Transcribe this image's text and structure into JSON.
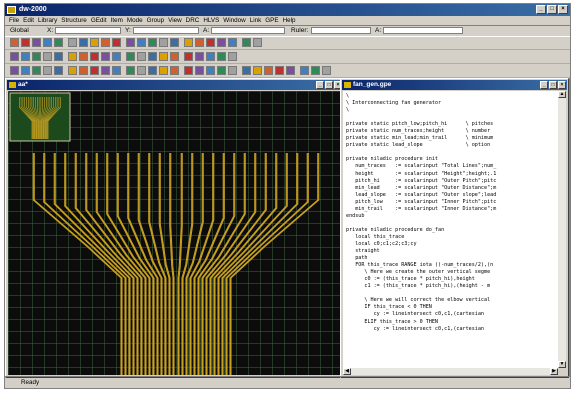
{
  "app": {
    "title": "dw-2000"
  },
  "menu": [
    "File",
    "Edit",
    "Library",
    "Structure",
    "GEdit",
    "Item",
    "Mode",
    "Group",
    "View",
    "DRC",
    "HLVS",
    "Window",
    "Link",
    "GPE",
    "Help"
  ],
  "coordbar": {
    "layer": "Global",
    "x_label": "X:",
    "y_label": "Y:",
    "a_label": "A:",
    "ruler_label": "Ruler:",
    "a2_label": "A:"
  },
  "layout_window": {
    "title": "aa*"
  },
  "editor_window": {
    "title": "fan_gen.gpe",
    "code": [
      "\\",
      "\\ Interconnecting fan generator",
      "\\",
      "",
      "private static pitch_low;pitch_hi      \\ pitches",
      "private static num_traces;height       \\ number ",
      "private static min_lead;min_trail      \\ minimum",
      "private static lead_slope              \\ option",
      "",
      "private niladic procedure init",
      "   num_traces   := scalarinput \"Total Lines\";num_",
      "   height       := scalarinput \"Height\";height;.1",
      "   pitch_hi     := scalarinput \"Outer Pitch\";pitc",
      "   min_lead     := scalarinput \"Outer Distance\";m",
      "   lead_slope   := scalarinput \"Outer slope\";lead",
      "   pitch_low    := scalarinput \"Inner Pitch\";pitc",
      "   min_trail    := scalarinput \"Inner Distance\";m",
      "endsub",
      "",
      "private niladic procedure do_fan",
      "   local this_trace",
      "   local c0;c1;c2;c3;cy",
      "   straight",
      "   path",
      "   FOR this_trace RANGE iota ((-num_traces/2),(n",
      "      \\ Here we create the outer vertical segme",
      "      c0 := (this_trace * pitch_hi),height",
      "      c1 := (this_trace * pitch_hi),(height - m",
      "",
      "      \\ Here we will correct the elbow vertical",
      "      IF this_trace < 0 THEN",
      "         cy := lineintersect c0,c1,(cartesian",
      "      ELIF this_trace > 0 THEN",
      "         cy := lineintersect c0,c1,(cartesian"
    ]
  },
  "status": {
    "text": "Ready"
  },
  "colors": {
    "trace": "#c8a020",
    "background": "#0c0c0c",
    "grid": "#466e46",
    "titlebar": "#0a246a"
  }
}
